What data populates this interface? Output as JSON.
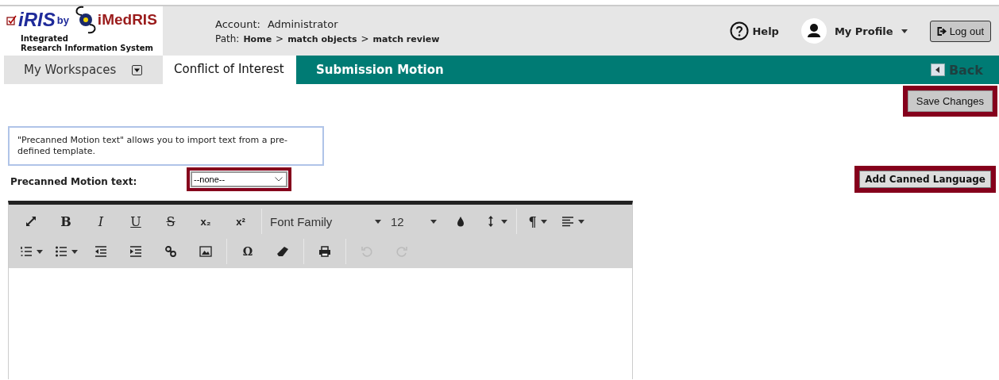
{
  "logo": {
    "product": "iRIS",
    "by": "by",
    "company": "iMedRIS",
    "subtitle_1": "Integrated",
    "subtitle_2": "Research Information System"
  },
  "account": {
    "label": "Account:",
    "value": "Administrator"
  },
  "path": {
    "label": "Path:",
    "crumbs": [
      "Home",
      "match objects",
      "match review"
    ],
    "separator": ">"
  },
  "help": "Help",
  "profile": "My Profile",
  "logout": "Log out",
  "tabs": [
    {
      "label": "My Workspaces",
      "kind": "menu",
      "selected": false
    },
    {
      "label": "Conflict of Interest",
      "kind": "plain",
      "selected": true
    }
  ],
  "page_title": "Submission Motion",
  "back": "Back",
  "save": {
    "label": "Save Changes",
    "highlighted": true
  },
  "info": "\"Precanned Motion text\" allows you to import text from a pre-defined template.",
  "precanned": {
    "label": "Precanned Motion text:",
    "value": "--none--",
    "highlighted": true
  },
  "add_canned": {
    "label": "Add Canned Language",
    "highlighted": true
  },
  "toolbar_rows": [
    [
      {
        "kind": "fullscreen",
        "disabled": false
      },
      {
        "kind": "bold",
        "label": "B",
        "disabled": false
      },
      {
        "kind": "italic",
        "label": "I",
        "disabled": false
      },
      {
        "kind": "underline",
        "label": "U",
        "disabled": false
      },
      {
        "kind": "strike",
        "label": "S",
        "disabled": false
      },
      {
        "kind": "sub",
        "label": "x₂",
        "disabled": false
      },
      {
        "kind": "sup",
        "label": "x²",
        "disabled": false
      },
      {
        "kind": "sep"
      },
      {
        "kind": "font-select",
        "label": "Font Family"
      },
      {
        "kind": "size-select",
        "label": "12"
      },
      {
        "kind": "color",
        "disabled": false
      },
      {
        "kind": "lineheight",
        "disabled": false
      },
      {
        "kind": "sep"
      },
      {
        "kind": "paragraph",
        "label": "¶",
        "disabled": false
      },
      {
        "kind": "align",
        "disabled": false
      }
    ],
    [
      {
        "kind": "ol",
        "disabled": false
      },
      {
        "kind": "ul",
        "disabled": false
      },
      {
        "kind": "outdent",
        "disabled": false
      },
      {
        "kind": "indent",
        "disabled": false
      },
      {
        "kind": "link",
        "disabled": false
      },
      {
        "kind": "image",
        "disabled": false
      },
      {
        "kind": "sep"
      },
      {
        "kind": "omega",
        "label": "Ω",
        "disabled": false
      },
      {
        "kind": "eraser",
        "disabled": false
      },
      {
        "kind": "sep"
      },
      {
        "kind": "print",
        "disabled": false
      },
      {
        "kind": "sep"
      },
      {
        "kind": "undo",
        "disabled": true
      },
      {
        "kind": "redo",
        "disabled": true
      }
    ]
  ]
}
